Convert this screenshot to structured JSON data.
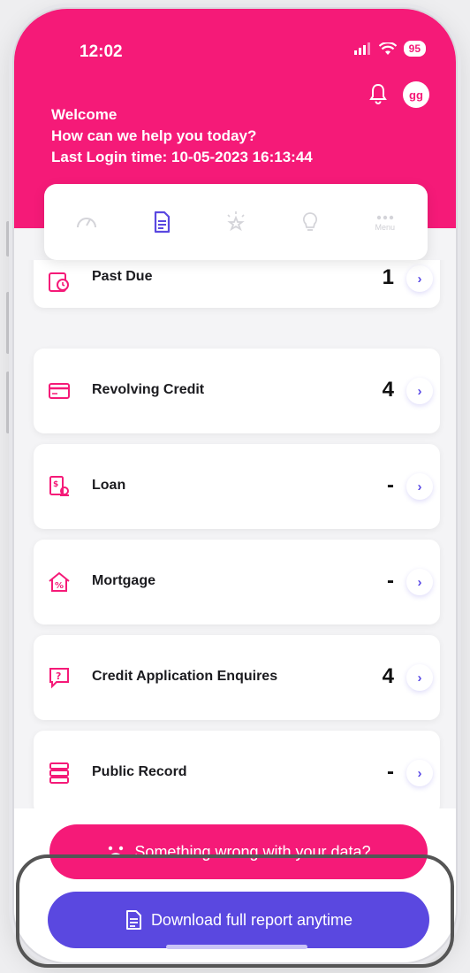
{
  "status_bar": {
    "time": "12:02",
    "battery": "95"
  },
  "header": {
    "welcome": "Welcome",
    "subtitle": "How can we help you today?",
    "last_login": "Last Login time: 10-05-2023 16:13:44",
    "avatar": "gg"
  },
  "tabs": {
    "menu_label": "Menu",
    "items": [
      "gauge-icon",
      "document-icon",
      "sparkle-star-icon",
      "lightbulb-icon",
      "more-dots-icon"
    ]
  },
  "cards": [
    {
      "label": "Past Due",
      "count": "1"
    },
    {
      "label": "Revolving Credit",
      "count": "4"
    },
    {
      "label": "Loan",
      "count": "-"
    },
    {
      "label": "Mortgage",
      "count": "-"
    },
    {
      "label": "Credit Application Enquires",
      "count": "4"
    },
    {
      "label": "Public Record",
      "count": "-"
    }
  ],
  "buttons": {
    "wrong_data": "Something wrong with your data?",
    "download": "Download full report anytime"
  },
  "colors": {
    "brand_pink": "#f51a78",
    "accent_purple": "#5a48e0"
  }
}
